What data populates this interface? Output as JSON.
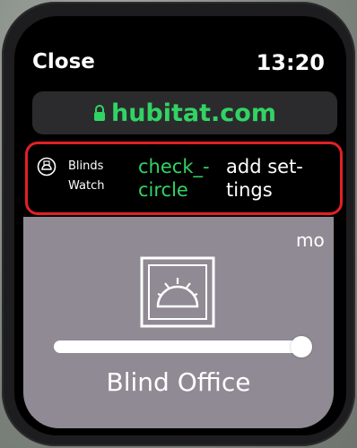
{
  "status_bar": {
    "close_label": "Close",
    "time": "13:20"
  },
  "url_bar": {
    "domain": "hubitat.com",
    "icon": "lock-icon"
  },
  "toolbar": {
    "app_name": "Blinds\nWatch",
    "app_icon": "blinds-watch-icon",
    "check_label": "check_-\ncircle",
    "settings_label": "add set-\ntings",
    "highlight_color": "#e32026"
  },
  "device": {
    "name": "Blind Office",
    "more_label": "mo",
    "icon": "blind-icon",
    "slider_level": 1.0
  },
  "colors": {
    "accent_green": "#32d365",
    "card_bg": "#8f8a93"
  }
}
